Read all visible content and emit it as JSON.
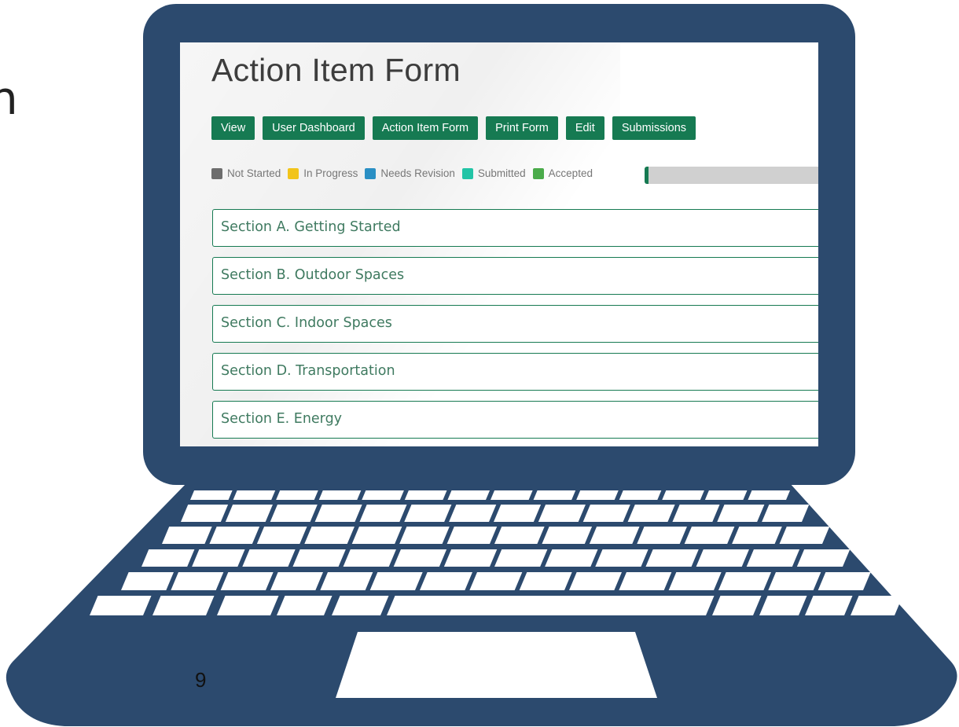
{
  "edge_text": "n",
  "page_number": "9",
  "screen": {
    "title": "Action Item Form",
    "buttons": [
      "View",
      "User Dashboard",
      "Action Item Form",
      "Print Form",
      "Edit",
      "Submissions"
    ],
    "legend": [
      {
        "label": "Not Started",
        "color": "#6d6d6d"
      },
      {
        "label": "In Progress",
        "color": "#f2c41a"
      },
      {
        "label": "Needs Revision",
        "color": "#2a8fc4"
      },
      {
        "label": "Submitted",
        "color": "#22c4a6"
      },
      {
        "label": "Accepted",
        "color": "#4aab4a"
      }
    ],
    "progress_fraction": 0.02,
    "sections": [
      "Section A. Getting Started",
      "Section B. Outdoor Spaces",
      "Section C. Indoor Spaces",
      "Section D. Transportation",
      "Section E. Energy"
    ]
  },
  "colors": {
    "laptop_body": "#2c4a6e",
    "button_green": "#167a52",
    "progress_track": "#d0d0d0"
  }
}
